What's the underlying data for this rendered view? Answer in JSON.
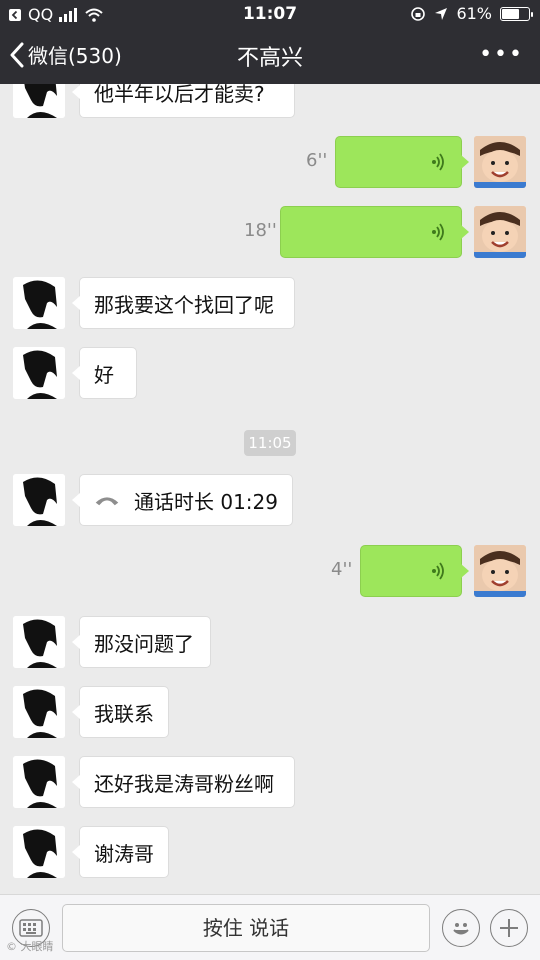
{
  "status": {
    "carrier": "QQ",
    "time": "11:07",
    "battery": "61%"
  },
  "nav": {
    "back_label": "微信(530)",
    "title": "不高兴",
    "more": "•••"
  },
  "messages": [
    {
      "text": "他半年以后才能卖?"
    },
    {
      "duration": "6''"
    },
    {
      "duration": "18''"
    },
    {
      "text": "那我要这个找回了呢"
    },
    {
      "text": "好"
    },
    {
      "time": "11:05"
    },
    {
      "text": "通话时长 01:29"
    },
    {
      "duration": "4''"
    },
    {
      "text": "那没问题了"
    },
    {
      "text": "我联系"
    },
    {
      "text": "还好我是涛哥粉丝啊"
    },
    {
      "text": "谢涛哥"
    }
  ],
  "input": {
    "hold_label": "按住 说话"
  },
  "watermark": "© 大眼睛"
}
